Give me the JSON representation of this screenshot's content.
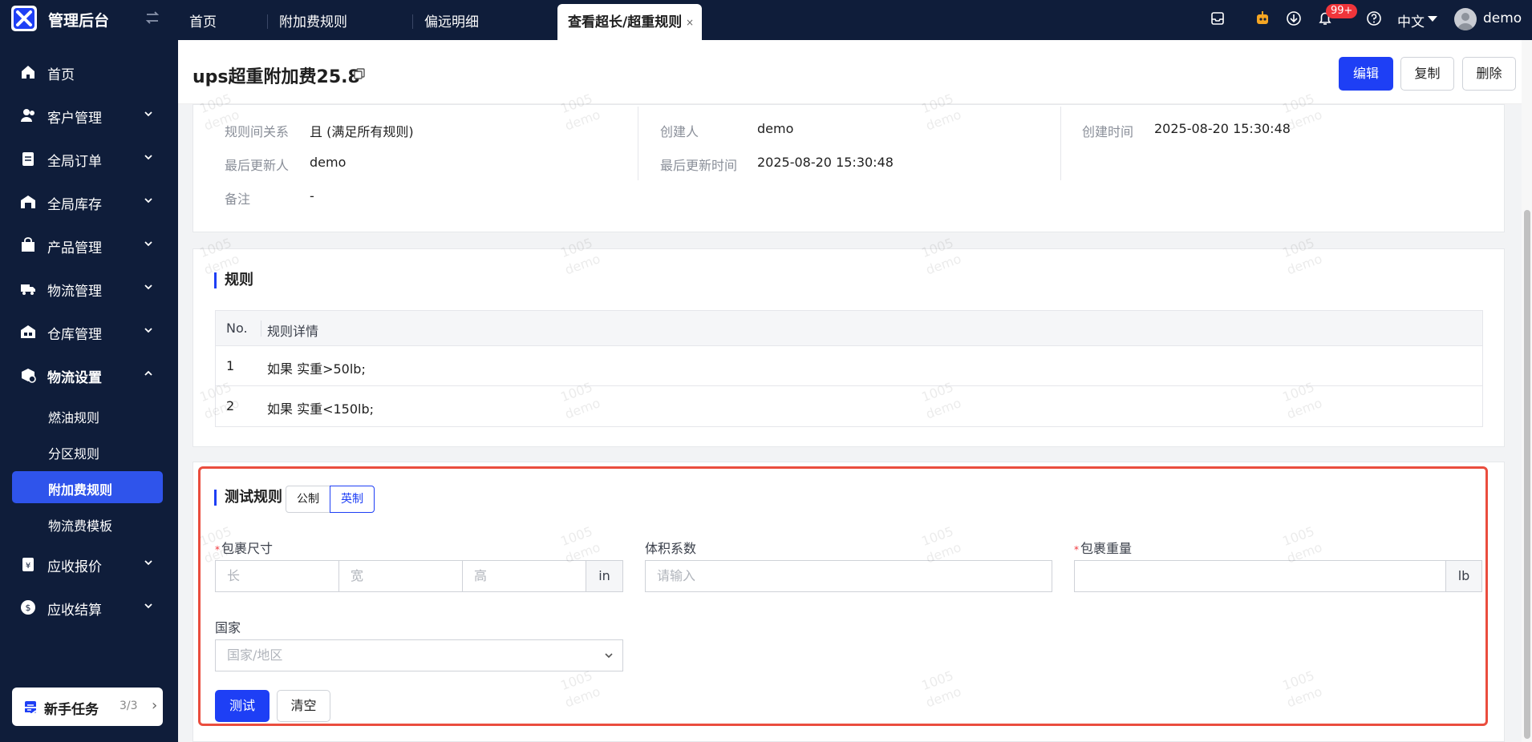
{
  "app": {
    "title": "管理后台"
  },
  "tabs": [
    {
      "label": "首页"
    },
    {
      "label": "附加费规则"
    },
    {
      "label": "偏远明细"
    },
    {
      "label": "查看超长/超重规则",
      "close": "×"
    }
  ],
  "topbar": {
    "notification_badge": "99+",
    "language": "中文",
    "user": "demo"
  },
  "sidebar": {
    "items": [
      {
        "label": "首页",
        "icon": "home-icon"
      },
      {
        "label": "客户管理",
        "icon": "customer-icon"
      },
      {
        "label": "全局订单",
        "icon": "order-icon"
      },
      {
        "label": "全局库存",
        "icon": "inventory-icon"
      },
      {
        "label": "产品管理",
        "icon": "product-icon"
      },
      {
        "label": "物流管理",
        "icon": "truck-icon"
      },
      {
        "label": "仓库管理",
        "icon": "warehouse-icon"
      },
      {
        "label": "物流设置",
        "icon": "logistics-settings-icon"
      },
      {
        "label": "应收报价",
        "icon": "quote-icon"
      },
      {
        "label": "应收结算",
        "icon": "settlement-icon"
      }
    ],
    "sub_items": [
      {
        "label": "燃油规则"
      },
      {
        "label": "分区规则"
      },
      {
        "label": "附加费规则"
      },
      {
        "label": "物流费模板"
      }
    ],
    "newbie": {
      "label": "新手任务",
      "count": "3/3",
      "arrow": "›"
    }
  },
  "page": {
    "title": "ups超重附加费25.8",
    "buttons": {
      "edit": "编辑",
      "copy": "复制",
      "delete": "删除"
    }
  },
  "info": {
    "relation_label": "规则间关系",
    "relation_value": "且 (满足所有规则)",
    "creator_label": "创建人",
    "creator_value": "demo",
    "created_time_label": "创建时间",
    "created_time_value": "2025-08-20 15:30:48",
    "updater_label": "最后更新人",
    "updater_value": "demo",
    "updated_time_label": "最后更新时间",
    "updated_time_value": "2025-08-20 15:30:48",
    "remark_label": "备注",
    "remark_value": "-"
  },
  "rules": {
    "title": "规则",
    "columns": [
      "No.",
      "规则详情"
    ],
    "rows": [
      {
        "no": "1",
        "detail": "如果 实重>50lb;"
      },
      {
        "no": "2",
        "detail": "如果 实重<150lb;"
      }
    ]
  },
  "test": {
    "title": "测试规则",
    "unit_metric": "公制",
    "unit_imperial": "英制",
    "size_label": "包裹尺寸",
    "required_mark": "*",
    "length_placeholder": "长",
    "width_placeholder": "宽",
    "height_placeholder": "高",
    "size_unit": "in",
    "volume_label": "体积系数",
    "volume_placeholder": "请输入",
    "weight_label": "包裹重量",
    "weight_unit": "lb",
    "country_label": "国家",
    "country_placeholder": "国家/地区",
    "test_button": "测试",
    "clear_button": "清空"
  },
  "watermark": {
    "line1": "1005",
    "line2": "demo"
  },
  "colors": {
    "primary": "#1e3ff5",
    "sidebar": "#0f1d3a",
    "highlight_border": "#ea4d3e",
    "badge": "#f0353b"
  }
}
